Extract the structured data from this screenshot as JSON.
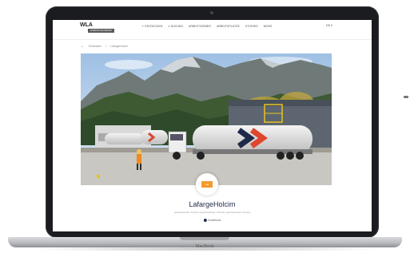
{
  "website": {
    "logo": "WLA",
    "logo_sub": "WORKPLACE AWARD",
    "nav": [
      {
        "label": "ENTDECKEN",
        "icon": "compass-icon"
      },
      {
        "label": "SUCHEN",
        "icon": "search-icon"
      },
      {
        "label": "ARBEITSGEBER",
        "icon": ""
      },
      {
        "label": "ARBEITSPLÄTZE",
        "icon": ""
      },
      {
        "label": "STORIES",
        "icon": ""
      },
      {
        "label": "NEWS",
        "icon": ""
      }
    ],
    "language": "DE ▾",
    "breadcrumb": [
      "Entdecken",
      "LafargeHolcim"
    ]
  },
  "company": {
    "name": "LafargeHolcim",
    "logo_label": "LH",
    "tags": "Agrarwirtschaft / Technik  |  Agrarwirtschaft / Technik  |  Agrarwirtschaft / Technik",
    "location": "Holderbank"
  },
  "device": {
    "brand": "MacBook"
  },
  "colors": {
    "brand_orange": "#f39a2e",
    "brand_navy": "#1f2a4a",
    "accent_blue": "#2f4fa8"
  }
}
